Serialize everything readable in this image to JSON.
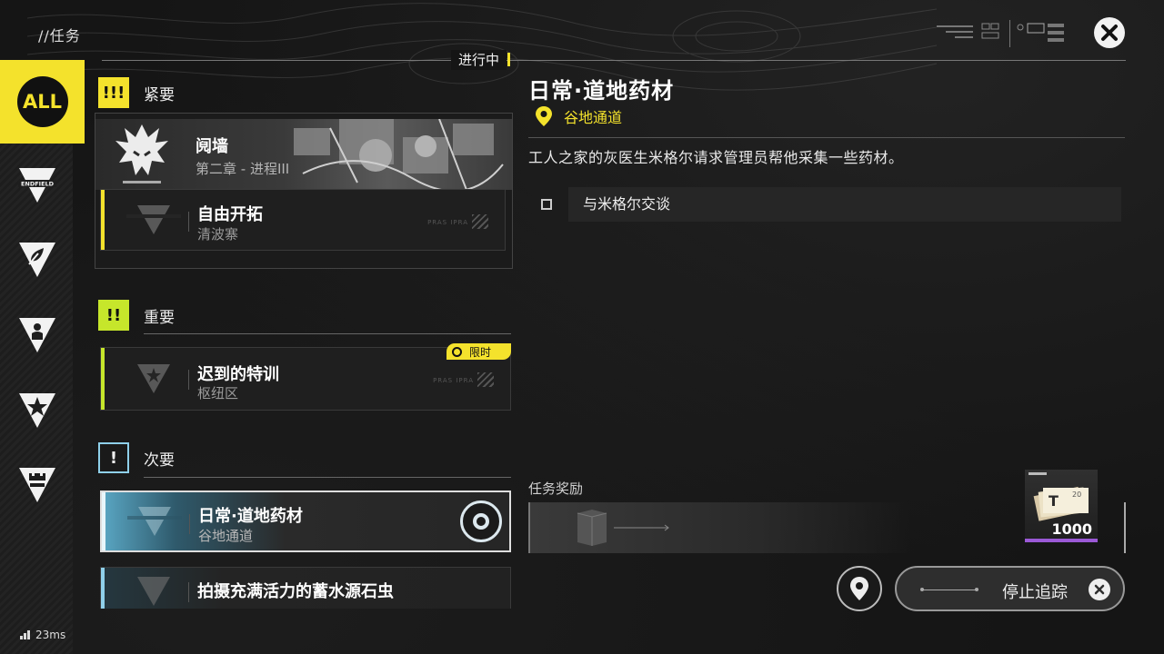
{
  "header": {
    "title": "//任务",
    "progress_tag": "进行中"
  },
  "sidebar": {
    "all_label": "ALL",
    "items": [
      {
        "icon": "endfield-icon",
        "label": "ENDFIELD"
      },
      {
        "icon": "leaf-icon"
      },
      {
        "icon": "person-icon"
      },
      {
        "icon": "star-icon"
      },
      {
        "icon": "fort-icon"
      }
    ],
    "active_color": "#f4e22c"
  },
  "sections": {
    "urgent": {
      "badge": "!!!",
      "label": "紧要",
      "hero": {
        "title": "阋墙",
        "subtitle": "第二章 - 进程III"
      },
      "card": {
        "title": "自由开拓",
        "subtitle": "清波寨",
        "code": "PRAS IPRA"
      }
    },
    "important": {
      "badge": "!!",
      "label": "重要",
      "card": {
        "title": "迟到的特训",
        "subtitle": "枢纽区",
        "code": "PRAS IPRA",
        "tag": "限时"
      }
    },
    "minor": {
      "badge": "!",
      "label": "次要",
      "cards": [
        {
          "title": "日常·道地药材",
          "subtitle": "谷地通道",
          "selected": true
        },
        {
          "title": "拍摄充满活力的蓄水源石虫",
          "subtitle": ""
        }
      ]
    }
  },
  "detail": {
    "title": "日常·道地药材",
    "location": "谷地通道",
    "description": "工人之家的灰医生米格尔请求管理员帮他采集一些药材。",
    "objective": "与米格尔交谈",
    "reward_label": "任务奖励",
    "reward_qty": "1000",
    "reward_item_corner": "20",
    "reward_rarity_color": "#9b59d6"
  },
  "actions": {
    "stop_tracking": "停止追踪"
  },
  "status": {
    "ping": "23ms"
  },
  "colors": {
    "accent_yellow": "#f4e22c",
    "important_green": "#c6e62b",
    "minor_blue": "#8fd0ea"
  }
}
